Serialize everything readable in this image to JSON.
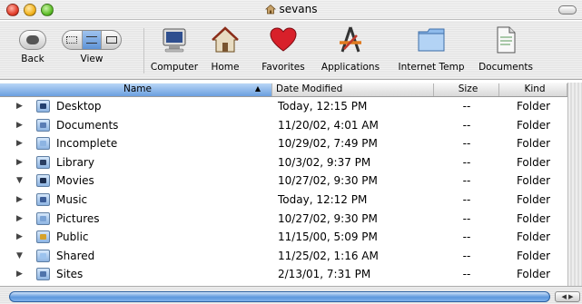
{
  "window": {
    "title": "sevans"
  },
  "toolbar": {
    "back_label": "Back",
    "view_label": "View",
    "locations": [
      {
        "label": "Computer",
        "icon": "computer-icon"
      },
      {
        "label": "Home",
        "icon": "home-icon"
      },
      {
        "label": "Favorites",
        "icon": "heart-icon"
      },
      {
        "label": "Applications",
        "icon": "applications-icon"
      },
      {
        "label": "Internet Temp",
        "icon": "folder-icon"
      },
      {
        "label": "Documents",
        "icon": "document-icon"
      }
    ]
  },
  "columns": {
    "name": "Name",
    "date": "Date Modified",
    "size": "Size",
    "kind": "Kind"
  },
  "rows": [
    {
      "name": "Desktop",
      "date": "Today, 12:15 PM",
      "size": "--",
      "kind": "Folder",
      "expanded": false
    },
    {
      "name": "Documents",
      "date": "11/20/02, 4:01 AM",
      "size": "--",
      "kind": "Folder",
      "expanded": false
    },
    {
      "name": "Incomplete",
      "date": "10/29/02, 7:49 PM",
      "size": "--",
      "kind": "Folder",
      "expanded": false
    },
    {
      "name": "Library",
      "date": "10/3/02, 9:37 PM",
      "size": "--",
      "kind": "Folder",
      "expanded": false
    },
    {
      "name": "Movies",
      "date": "10/27/02, 9:30 PM",
      "size": "--",
      "kind": "Folder",
      "expanded": true
    },
    {
      "name": "Music",
      "date": "Today, 12:12 PM",
      "size": "--",
      "kind": "Folder",
      "expanded": false
    },
    {
      "name": "Pictures",
      "date": "10/27/02, 9:30 PM",
      "size": "--",
      "kind": "Folder",
      "expanded": false
    },
    {
      "name": "Public",
      "date": "11/15/00, 5:09 PM",
      "size": "--",
      "kind": "Folder",
      "expanded": false
    },
    {
      "name": "Shared",
      "date": "11/25/02, 1:16 AM",
      "size": "--",
      "kind": "Folder",
      "expanded": true
    },
    {
      "name": "Sites",
      "date": "2/13/01, 7:31 PM",
      "size": "--",
      "kind": "Folder",
      "expanded": false
    }
  ],
  "colors": {
    "selected_column": "#6b9fdf",
    "scroll_thumb": "#5c97dc"
  }
}
